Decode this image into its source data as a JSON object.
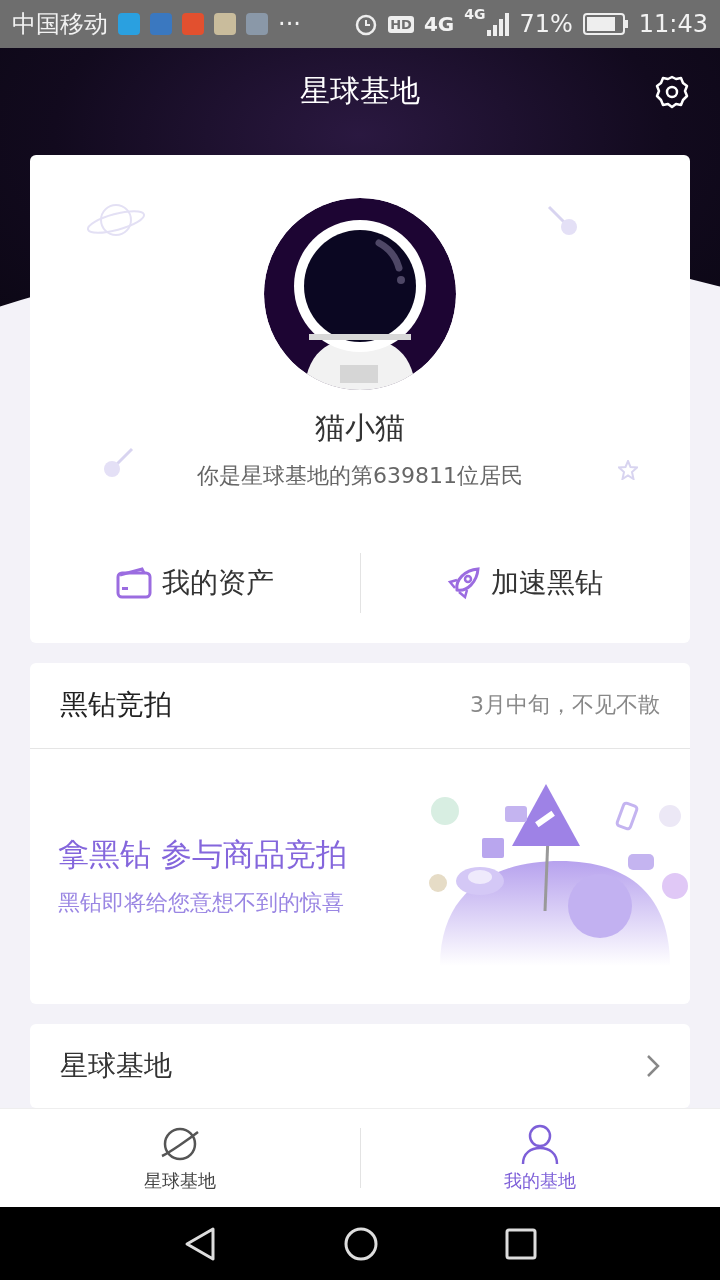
{
  "status_bar": {
    "carrier": "中国移动",
    "more": "···",
    "hd": "HD",
    "network": "4G",
    "signal_label": "4G",
    "battery": "71%",
    "time": "11:43"
  },
  "header": {
    "title": "星球基地"
  },
  "profile": {
    "name": "猫小猫",
    "subtitle": "你是星球基地的第639811位居民",
    "actions": [
      {
        "label": "我的资产",
        "kind": "wallet"
      },
      {
        "label": "加速黑钻",
        "kind": "rocket"
      }
    ]
  },
  "auction": {
    "title": "黑钻竞拍",
    "note": "3月中旬，不见不散",
    "headline": "拿黑钻 参与商品竞拍",
    "tagline": "黑钻即将给您意想不到的惊喜"
  },
  "link_row": {
    "label": "星球基地"
  },
  "tabs": [
    {
      "label": "星球基地",
      "kind": "planet",
      "selected": false
    },
    {
      "label": "我的基地",
      "kind": "person",
      "selected": true
    }
  ]
}
